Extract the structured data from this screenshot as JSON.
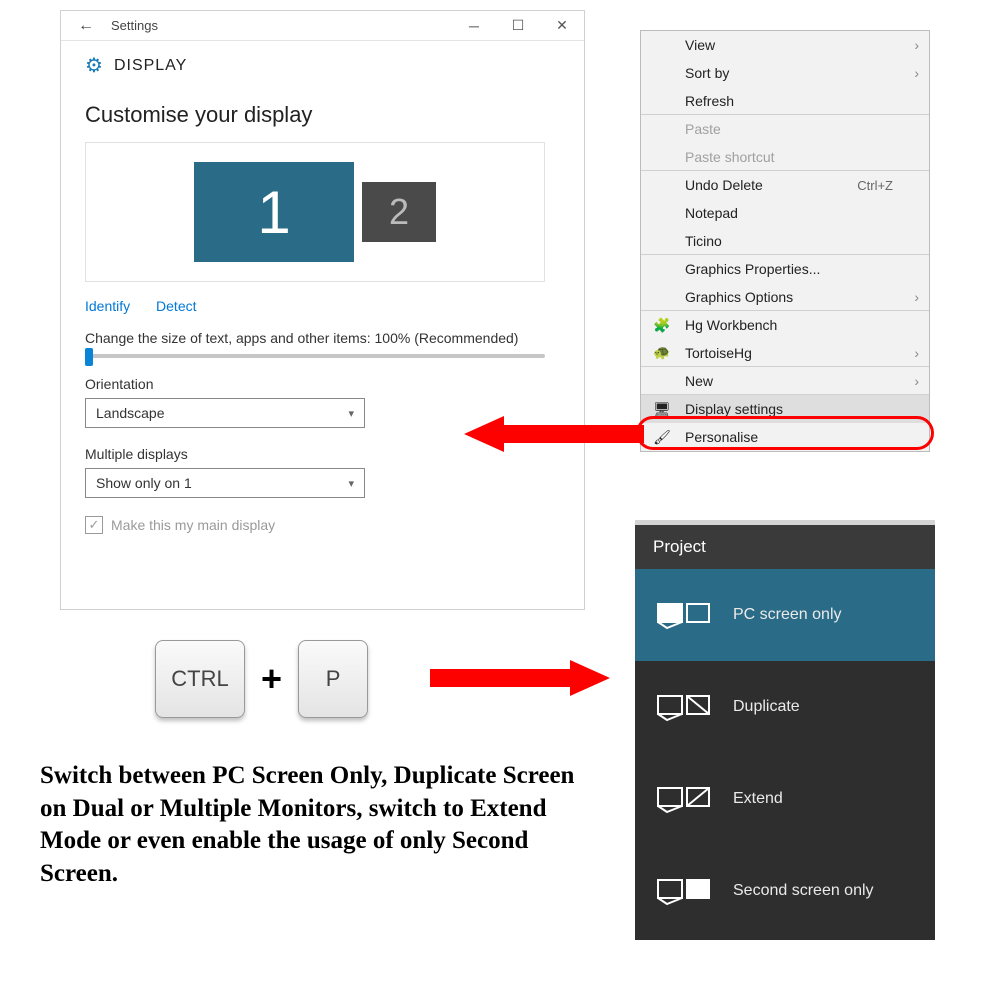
{
  "settings": {
    "app_title": "Settings",
    "header": "DISPLAY",
    "section_title": "Customise your display",
    "display1": "1",
    "display2": "2",
    "identify": "Identify",
    "detect": "Detect",
    "slider_label": "Change the size of text, apps and other items: 100% (Recommended)",
    "orientation_label": "Orientation",
    "orientation_value": "Landscape",
    "multiple_label": "Multiple displays",
    "multiple_value": "Show only on 1",
    "maindisplay_label": "Make this my main display"
  },
  "context": {
    "view": "View",
    "sort": "Sort by",
    "refresh": "Refresh",
    "paste": "Paste",
    "paste_shortcut": "Paste shortcut",
    "undo": "Undo Delete",
    "undo_key": "Ctrl+Z",
    "notepad": "Notepad",
    "ticino": "Ticino",
    "gprops": "Graphics Properties...",
    "gopts": "Graphics Options",
    "hg": "Hg Workbench",
    "tortoise": "TortoiseHg",
    "newitem": "New",
    "display_settings": "Display settings",
    "personalise": "Personalise"
  },
  "keys": {
    "ctrl": "CTRL",
    "plus": "+",
    "p": "P"
  },
  "project": {
    "title": "Project",
    "pc_only": "PC screen only",
    "duplicate": "Duplicate",
    "extend": "Extend",
    "second_only": "Second screen only"
  },
  "caption": "Switch between PC Screen Only, Duplicate Screen on Dual or Multiple Monitors, switch to Extend Mode or even enable the usage of only Second Screen."
}
